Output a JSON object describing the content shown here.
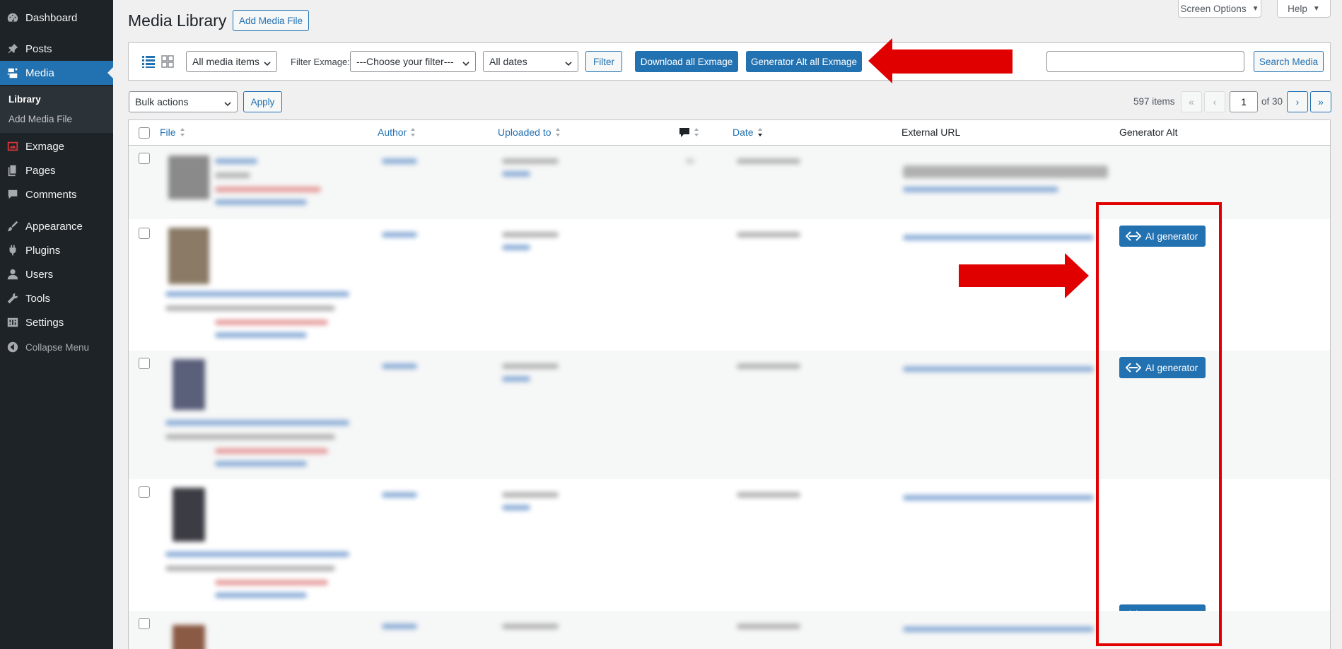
{
  "sidebar": {
    "items": [
      {
        "label": "Dashboard",
        "icon": "dashboard-icon"
      },
      {
        "label": "Posts",
        "icon": "pin-icon"
      },
      {
        "label": "Media",
        "icon": "media-icon",
        "active": true
      },
      {
        "label": "Exmage",
        "icon": "image-chart-icon"
      },
      {
        "label": "Pages",
        "icon": "pages-icon"
      },
      {
        "label": "Comments",
        "icon": "comment-icon"
      },
      {
        "label": "Appearance",
        "icon": "brush-icon"
      },
      {
        "label": "Plugins",
        "icon": "plugin-icon"
      },
      {
        "label": "Users",
        "icon": "user-icon"
      },
      {
        "label": "Tools",
        "icon": "wrench-icon"
      },
      {
        "label": "Settings",
        "icon": "settings-icon"
      }
    ],
    "submenu": [
      "Library",
      "Add Media File"
    ],
    "collapse_label": "Collapse Menu"
  },
  "header": {
    "title": "Media Library",
    "add_button": "Add Media File",
    "screen_options": "Screen Options",
    "help": "Help"
  },
  "filter_bar": {
    "media_type": "All media items",
    "filter_exmage_label": "Filter Exmage:",
    "filter_exmage_value": "---Choose your filter---",
    "dates": "All dates",
    "filter_button": "Filter",
    "download_all": "Download all Exmage",
    "generator_alt_all": "Generator Alt all Exmage",
    "search_placeholder": "",
    "search_button": "Search Media"
  },
  "bulk": {
    "selected": "Bulk actions",
    "apply": "Apply"
  },
  "pagination": {
    "total": "597 items",
    "first": "«",
    "prev": "‹",
    "current_page": "1",
    "of_total": "of 30",
    "next": "›",
    "last": "»"
  },
  "table": {
    "columns": [
      "File",
      "Author",
      "Uploaded to",
      "Date",
      "External URL",
      "Generator Alt"
    ],
    "ai_button_label": "AI generator"
  },
  "colors": {
    "sidebar_bg": "#1d2327",
    "accent": "#2271b1",
    "annotation_red": "#e00000"
  }
}
